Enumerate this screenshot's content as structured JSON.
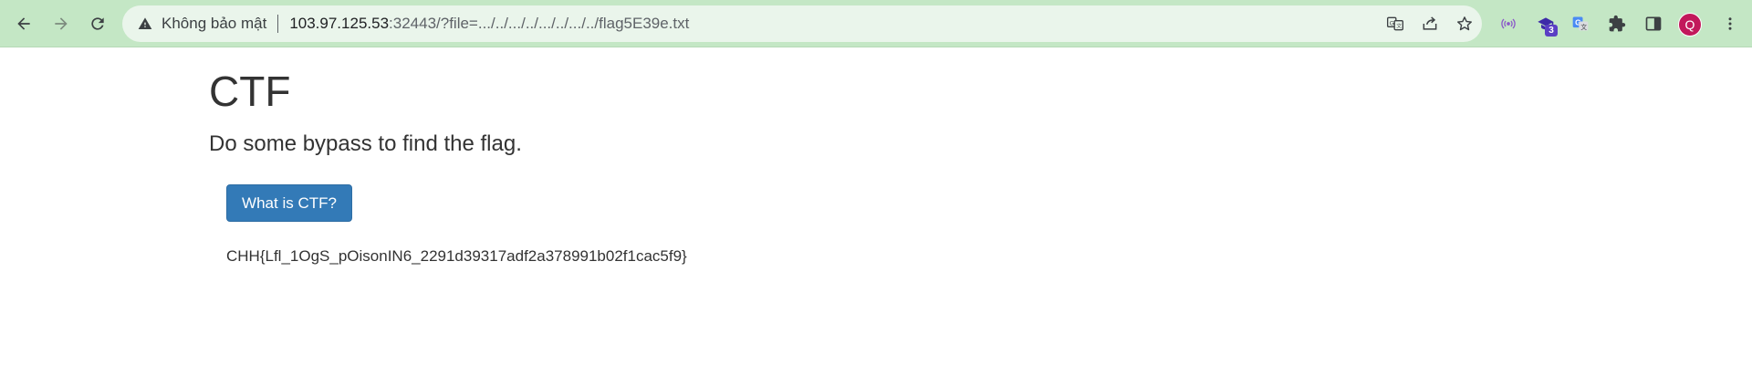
{
  "browser": {
    "security_label": "Không bảo mật",
    "url_host": "103.97.125.53",
    "url_rest": ":32443/?file=.../../.../../.../../.../../flag5E39e.txt",
    "extension_badge": "3",
    "profile_initial": "Q",
    "icons": {
      "back": "arrow-left-icon",
      "forward": "arrow-right-icon",
      "reload": "reload-icon",
      "warning": "warning-triangle-icon",
      "translate": "translate-icon",
      "share": "share-icon",
      "bookmark": "star-icon",
      "extensions": "puzzle-icon",
      "side_panel": "side-panel-icon",
      "menu": "kebab-menu-icon"
    },
    "colors": {
      "frame": "#c4e7c5",
      "omnibox": "#eaf5eb",
      "avatar": "#c2185b"
    }
  },
  "page": {
    "title": "CTF",
    "subtitle": "Do some bypass to find the flag.",
    "button_label": "What is CTF?",
    "flag_text": "CHH{Lfl_1OgS_pOisonIN6_2291d39317adf2a378991b02f1cac5f9}",
    "colors": {
      "button": "#337ab7",
      "text": "#333333"
    }
  }
}
